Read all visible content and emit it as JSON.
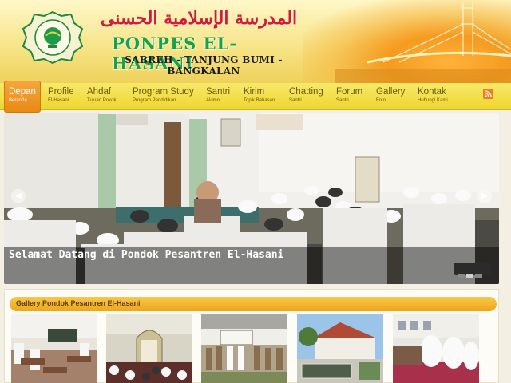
{
  "header": {
    "arabic_title": "المدرسة الإسلامية الحسنى",
    "title": "PONPES EL-HASANI",
    "subtitle": "SABREH - TANJUNG BUMI - BANGKALAN"
  },
  "nav": {
    "items": [
      {
        "label": "Depan",
        "sub": "Beranda",
        "active": true
      },
      {
        "label": "Profile",
        "sub": "El-Hasani"
      },
      {
        "label": "Ahdaf",
        "sub": "Tujuan Pokok"
      },
      {
        "label": "Program Study",
        "sub": "Program Pendidikan"
      },
      {
        "label": "Santri",
        "sub": "Alumni"
      },
      {
        "label": "Kirim",
        "sub": "Topik Bahasan"
      },
      {
        "label": "Chatting",
        "sub": "Santri"
      },
      {
        "label": "Forum",
        "sub": "Santri"
      },
      {
        "label": "Gallery",
        "sub": "Foto"
      },
      {
        "label": "Kontak",
        "sub": "Hubungi Kami"
      }
    ],
    "rss_icon": "rss-icon"
  },
  "slider": {
    "caption": "Selamat Datang di Pondok Pesantren El-Hasani",
    "prev_icon": "chevron-left-icon",
    "next_icon": "chevron-right-icon",
    "active_slide": 2,
    "slide_count": 3
  },
  "gallery": {
    "title": "Gallery Pondok Pesantren El-Hasani",
    "thumbs": [
      "classroom-photo",
      "mosque-interior-photo",
      "group-photo",
      "courtyard-photo",
      "students-seated-photo"
    ]
  },
  "colors": {
    "accent": "#e98a15",
    "nav_bg": "#eed52f",
    "title_green": "#14a24a",
    "arabic_red": "#d11b3a"
  }
}
